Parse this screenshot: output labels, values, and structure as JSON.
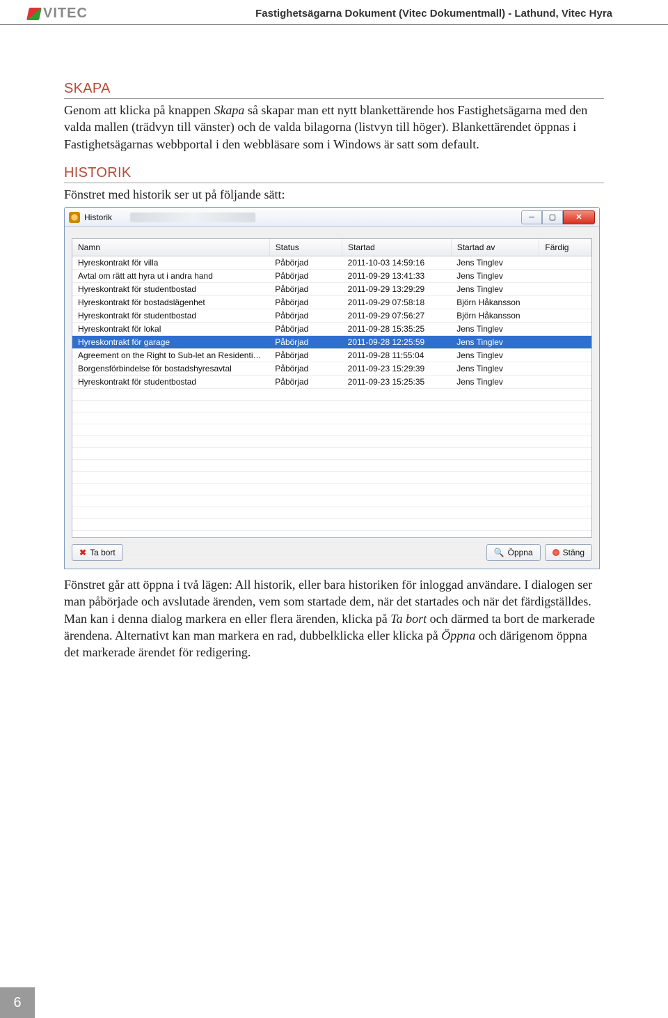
{
  "header": {
    "logo_text": "VITEC",
    "doc_title": "Fastighetsägarna Dokument (Vitec Dokumentmall) - Lathund, Vitec Hyra"
  },
  "section_skapa": {
    "heading": "SKAPA",
    "body_pre": "Genom att klicka på knappen ",
    "body_em1": "Skapa",
    "body_post": " så skapar man ett nytt blankettärende hos Fastighetsägarna med den valda mallen (trädvyn till vänster) och de valda bilagorna (listvyn till höger). Blankettärendet öppnas i Fastighetsägarnas webbportal i den webbläsare som i Windows är satt som default."
  },
  "section_historik": {
    "heading": "HISTORIK",
    "intro": "Fönstret med historik ser ut på följande sätt:",
    "after_pre": "Fönstret går att öppna i två lägen: All historik, eller bara historiken för inloggad användare. I dialogen ser man påbörjade och avslutade ärenden, vem som startade dem, när det startades och när det färdigställdes. Man kan i denna dialog markera en eller flera ärenden, klicka på ",
    "after_em1": "Ta bort",
    "after_mid": " och därmed ta bort de markerade ärendena. Alternativt kan man markera en rad, dubbelklicka eller klicka på ",
    "after_em2": "Öppna",
    "after_post": " och därigenom öppna det markerade ärendet för redigering."
  },
  "dialog": {
    "title": "Historik",
    "columns": {
      "name": "Namn",
      "status": "Status",
      "started": "Startad",
      "by": "Startad av",
      "done": "Färdig"
    },
    "rows": [
      {
        "name": "Hyreskontrakt för villa",
        "status": "Påbörjad",
        "started": "2011-10-03 14:59:16",
        "by": "Jens Tinglev",
        "done": ""
      },
      {
        "name": "Avtal om rätt att hyra ut i andra hand",
        "status": "Påbörjad",
        "started": "2011-09-29 13:41:33",
        "by": "Jens Tinglev",
        "done": ""
      },
      {
        "name": "Hyreskontrakt för studentbostad",
        "status": "Påbörjad",
        "started": "2011-09-29 13:29:29",
        "by": "Jens Tinglev",
        "done": ""
      },
      {
        "name": "Hyreskontrakt för bostadslägenhet",
        "status": "Påbörjad",
        "started": "2011-09-29 07:58:18",
        "by": "Björn  Håkansson",
        "done": ""
      },
      {
        "name": "Hyreskontrakt för studentbostad",
        "status": "Påbörjad",
        "started": "2011-09-29 07:56:27",
        "by": "Björn  Håkansson",
        "done": ""
      },
      {
        "name": "Hyreskontrakt för lokal",
        "status": "Påbörjad",
        "started": "2011-09-28 15:35:25",
        "by": "Jens Tinglev",
        "done": ""
      },
      {
        "name": "Hyreskontrakt för garage",
        "status": "Påbörjad",
        "started": "2011-09-28 12:25:59",
        "by": "Jens Tinglev",
        "done": "",
        "selected": true
      },
      {
        "name": "Agreement on the Right to Sub-let an Residential Ap...",
        "status": "Påbörjad",
        "started": "2011-09-28 11:55:04",
        "by": "Jens Tinglev",
        "done": ""
      },
      {
        "name": "Borgensförbindelse för bostadshyresavtal",
        "status": "Påbörjad",
        "started": "2011-09-23 15:29:39",
        "by": "Jens Tinglev",
        "done": ""
      },
      {
        "name": "Hyreskontrakt för studentbostad",
        "status": "Påbörjad",
        "started": "2011-09-23 15:25:35",
        "by": "Jens Tinglev",
        "done": ""
      }
    ],
    "buttons": {
      "delete": "Ta bort",
      "open": "Öppna",
      "close": "Stäng"
    }
  },
  "page_number": "6"
}
